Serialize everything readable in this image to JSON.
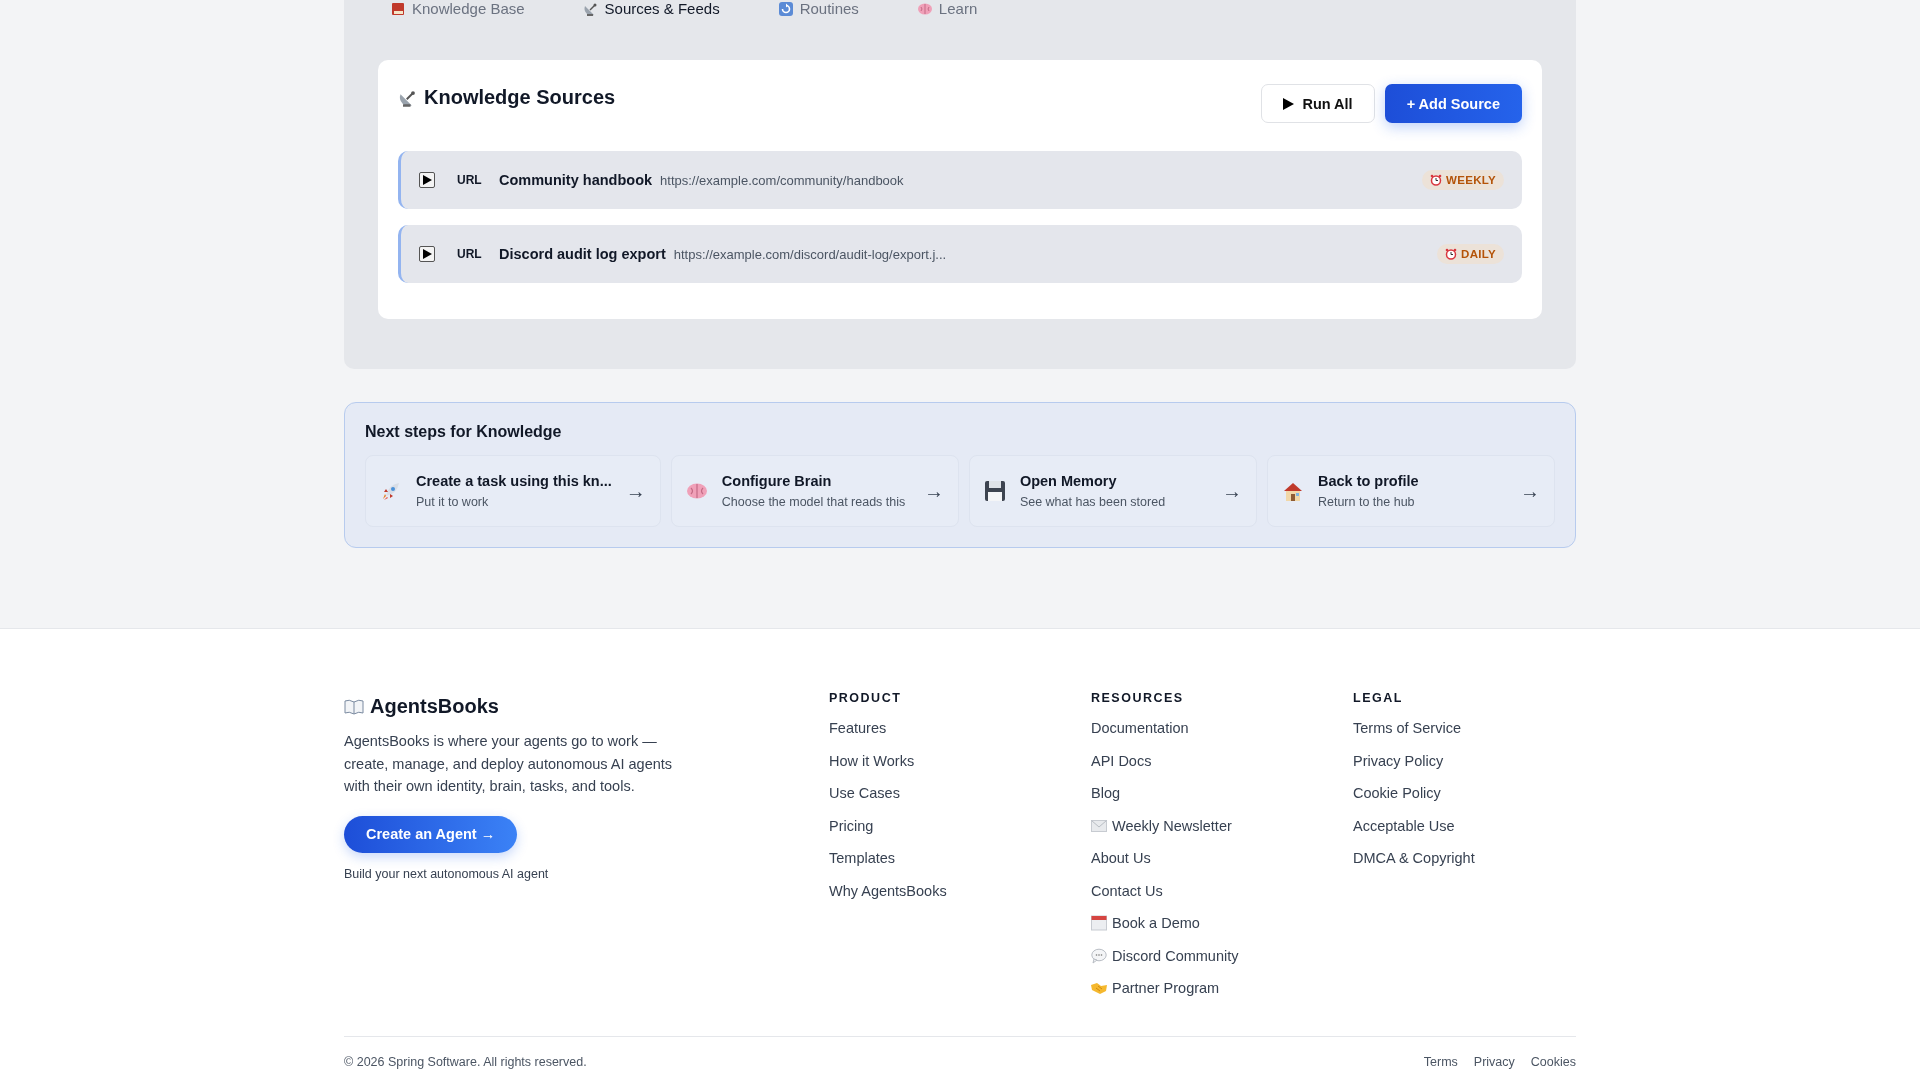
{
  "tabs": [
    {
      "label": "Knowledge Base",
      "selected": false
    },
    {
      "label": "Sources & Feeds",
      "selected": true
    },
    {
      "label": "Routines",
      "selected": false
    },
    {
      "label": "Learn",
      "selected": false
    }
  ],
  "sources_card": {
    "title": "Knowledge Sources",
    "buttons": [
      {
        "label": "Run All",
        "kind": "secondary"
      },
      {
        "label": "+ Add Source",
        "kind": "primary"
      }
    ],
    "sources": [
      {
        "type": "URL",
        "name": "Community handbook",
        "url": "https://example.com/community/handbook",
        "schedule": "WEEKLY"
      },
      {
        "type": "URL",
        "name": "Discord audit log export",
        "url": "https://example.com/discord/audit-log/export.j...",
        "schedule": "DAILY"
      }
    ]
  },
  "next_steps": {
    "title": "Next steps for Knowledge",
    "items": [
      {
        "title": "Create a task using this kn...",
        "subtitle": "Put it to work",
        "arrow": "→"
      },
      {
        "title": "Configure Brain",
        "subtitle": "Choose the model that reads this",
        "arrow": "→"
      },
      {
        "title": "Open Memory",
        "subtitle": "See what has been stored",
        "arrow": "→"
      },
      {
        "title": "Back to profile",
        "subtitle": "Return to the hub",
        "arrow": "→"
      }
    ]
  },
  "footer": {
    "brand": "AgentsBooks",
    "description": "AgentsBooks is where your agents go to work — create, manage, and deploy autonomous AI agents with their own identity, brain, tasks, and tools.",
    "cta": "Create an Agent →",
    "cta_note": "Build your next autonomous AI agent",
    "columns": [
      {
        "heading": "PRODUCT",
        "links": [
          "Features",
          "How it Works",
          "Use Cases",
          "Pricing",
          "Templates",
          "Why AgentsBooks"
        ]
      },
      {
        "heading": "RESOURCES",
        "links": [
          "Documentation",
          "API Docs",
          "Blog",
          "Weekly Newsletter",
          "About Us",
          "Contact Us",
          "Book a Demo",
          "Discord Community",
          "Partner Program"
        ]
      },
      {
        "heading": "LEGAL",
        "links": [
          "Terms of Service",
          "Privacy Policy",
          "Cookie Policy",
          "Acceptable Use",
          "DMCA & Copyright"
        ]
      }
    ],
    "copyright": "© 2026 Spring Software. All rights reserved.",
    "bottom_links": [
      "Terms",
      "Privacy",
      "Cookies"
    ]
  }
}
